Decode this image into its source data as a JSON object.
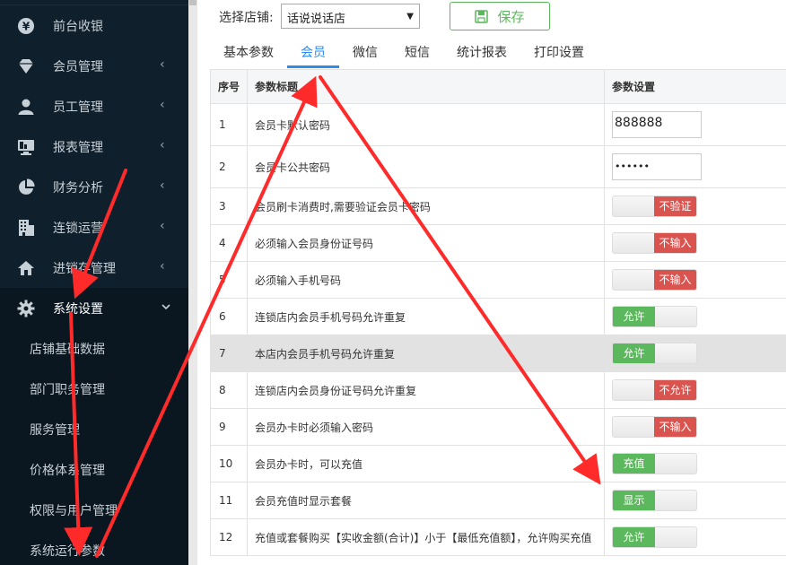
{
  "sidebar": {
    "items": [
      {
        "label": "前台收银",
        "icon": "yen-icon",
        "arrow": false
      },
      {
        "label": "会员管理",
        "icon": "diamond-icon",
        "arrow": true
      },
      {
        "label": "员工管理",
        "icon": "user-icon",
        "arrow": true
      },
      {
        "label": "报表管理",
        "icon": "monitor-icon",
        "arrow": true
      },
      {
        "label": "财务分析",
        "icon": "pie-chart-icon",
        "arrow": true
      },
      {
        "label": "连锁运营",
        "icon": "building-icon",
        "arrow": true
      },
      {
        "label": "进销存管理",
        "icon": "home-icon",
        "arrow": true
      },
      {
        "label": "系统设置",
        "icon": "gear-icon",
        "arrow": true
      }
    ],
    "subitems": [
      "店铺基础数据",
      "部门职务管理",
      "服务管理",
      "价格体系管理",
      "权限与用户管理",
      "系统运行参数"
    ]
  },
  "toolbar": {
    "store_label": "选择店铺:",
    "store_value": "话说说话店",
    "save_label": "保存"
  },
  "tabs": [
    "基本参数",
    "会员",
    "微信",
    "短信",
    "统计报表",
    "打印设置"
  ],
  "active_tab": "会员",
  "table": {
    "headers": [
      "序号",
      "参数标题",
      "参数设置"
    ],
    "rows": [
      {
        "no": "1",
        "title": "会员卡默认密码",
        "type": "input",
        "value": "888888"
      },
      {
        "no": "2",
        "title": "会员卡公共密码",
        "type": "password",
        "value": "••••••"
      },
      {
        "no": "3",
        "title": "会员刷卡消费时,需要验证会员卡密码",
        "type": "switch",
        "state": "off",
        "label": "不验证"
      },
      {
        "no": "4",
        "title": "必须输入会员身份证号码",
        "type": "switch",
        "state": "off",
        "label": "不输入"
      },
      {
        "no": "5",
        "title": "必须输入手机号码",
        "type": "switch",
        "state": "off",
        "label": "不输入"
      },
      {
        "no": "6",
        "title": "连锁店内会员手机号码允许重复",
        "type": "switch",
        "state": "on",
        "label": "允许"
      },
      {
        "no": "7",
        "title": "本店内会员手机号码允许重复",
        "type": "switch",
        "state": "on",
        "label": "允许"
      },
      {
        "no": "8",
        "title": "连锁店内会员身份证号码允许重复",
        "type": "switch",
        "state": "off",
        "label": "不允许"
      },
      {
        "no": "9",
        "title": "会员办卡时必须输入密码",
        "type": "switch",
        "state": "off",
        "label": "不输入"
      },
      {
        "no": "10",
        "title": "会员办卡时，可以充值",
        "type": "switch",
        "state": "on",
        "label": "充值"
      },
      {
        "no": "11",
        "title": "会员充值时显示套餐",
        "type": "switch",
        "state": "on",
        "label": "显示"
      },
      {
        "no": "12",
        "title": "充值或套餐购买【实收金额(合计)】小于【最低充值额】，允许购买充值",
        "type": "switch",
        "state": "on",
        "label": "允许"
      }
    ]
  },
  "colors": {
    "sidebar_bg": "#0f1f2c",
    "accent": "#2d8cf0",
    "on": "#5cb85c",
    "off": "#d9534f",
    "arrow": "#ff2a2a"
  }
}
